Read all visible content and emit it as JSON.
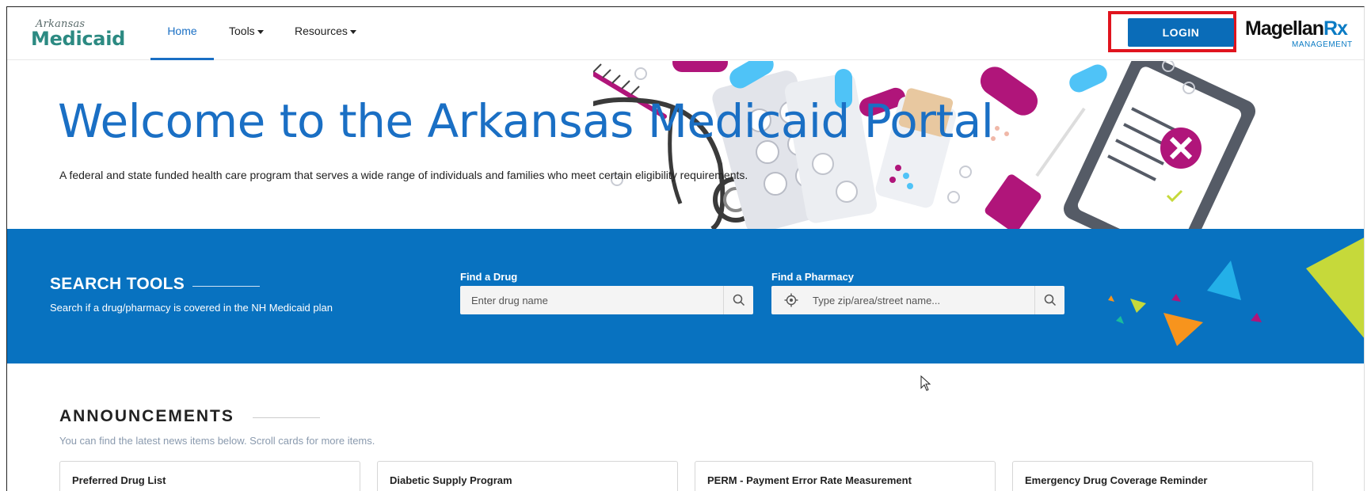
{
  "header": {
    "logo_script": "Arkansas",
    "logo_main": "Medicaid",
    "nav": {
      "home": "Home",
      "tools": "Tools",
      "resources": "Resources"
    },
    "login_label": "LOGIN",
    "partner_logo": {
      "name": "Magellan",
      "rx": "Rx",
      "sub": "MANAGEMENT"
    }
  },
  "hero": {
    "title": "Welcome to the Arkansas Medicaid Portal",
    "subtitle": "A federal and state funded health care program that serves a wide range of individuals and families who meet certain eligibility requirements."
  },
  "search_tools": {
    "title": "SEARCH TOOLS",
    "subtitle": "Search if a drug/pharmacy is covered in the NH Medicaid plan",
    "drug": {
      "label": "Find a Drug",
      "placeholder": "Enter drug name",
      "value": ""
    },
    "pharmacy": {
      "label": "Find a Pharmacy",
      "placeholder": "Type zip/area/street name...",
      "value": ""
    }
  },
  "announcements": {
    "title": "ANNOUNCEMENTS",
    "subtitle": "You can find the latest news items below. Scroll cards for more items.",
    "cards": [
      {
        "title": "Preferred Drug List"
      },
      {
        "title": "Diabetic Supply Program"
      },
      {
        "title": "PERM - Payment Error Rate Measurement"
      },
      {
        "title": "Emergency Drug Coverage Reminder"
      }
    ]
  },
  "colors": {
    "brand_blue": "#0872c0",
    "link_blue": "#1a6fc4",
    "login_highlight": "#e0141e",
    "medicaid_teal": "#2c8a82"
  },
  "icons": [
    "search-icon",
    "locate-icon",
    "caret-down-icon",
    "cursor-icon"
  ]
}
